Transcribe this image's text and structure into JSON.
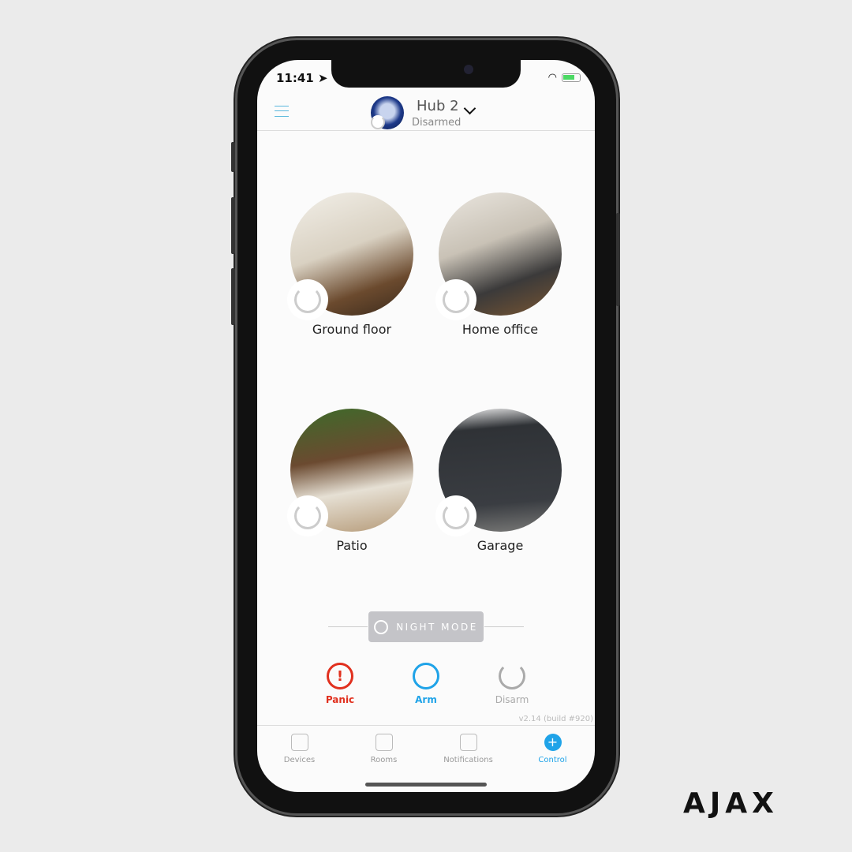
{
  "status_bar": {
    "time": "11:41",
    "location_icon": "➤",
    "wifi_icon": "wifi-icon",
    "battery_icon": "battery-charging-icon"
  },
  "header": {
    "hub_name": "Hub 2",
    "hub_status": "Disarmed"
  },
  "rooms": [
    {
      "name": "Ground floor",
      "gradient": "linear-gradient(160deg,#f2efe8 0%,#d9d1c2 45%,#6b4a2e 75%,#3a2a1c 100%)"
    },
    {
      "name": "Home office",
      "gradient": "linear-gradient(160deg,#eae6df 0%,#c9c2b6 40%,#3b3a3a 70%,#7a5632 100%)"
    },
    {
      "name": "Patio",
      "gradient": "linear-gradient(170deg,#3d6b2a 0%,#6b4a30 40%,#e6e0d4 65%,#b59a78 100%)"
    },
    {
      "name": "Garage",
      "gradient": "linear-gradient(175deg,#f0f0f0 0%,#2f3236 18%,#3a3d42 75%,#7a7a78 100%)"
    }
  ],
  "night_mode": {
    "label": "NIGHT MODE"
  },
  "actions": [
    {
      "label": "Panic",
      "color": "#e1301e",
      "symbol": "!"
    },
    {
      "label": "Arm",
      "color": "#1fa3e8",
      "symbol": ""
    },
    {
      "label": "Disarm",
      "color": "#aaaaaa",
      "symbol": ""
    }
  ],
  "version": "v2.14 (build #920)",
  "tabs": [
    {
      "label": "Devices"
    },
    {
      "label": "Rooms"
    },
    {
      "label": "Notifications"
    },
    {
      "label": "Control",
      "active": true
    }
  ],
  "colors": {
    "accent": "#1fa3e8",
    "panic": "#e1301e"
  },
  "brand": "AJAX"
}
